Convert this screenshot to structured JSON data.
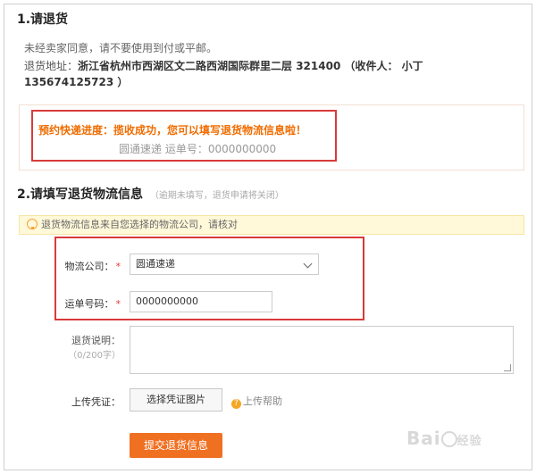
{
  "section1": {
    "title": "1.请退货",
    "notice": "未经卖家同意，请不要使用到付或平邮。",
    "address_label": "退货地址：",
    "address_value": "浙江省杭州市西湖区文二路西湖国际群里二层 321400 （收件人： 小丁",
    "address_phone": "135674125723 ）",
    "progress_title": "预约快递进度：揽收成功，您可以填写退货物流信息啦！",
    "progress_detail": "圆通速递 运单号：0000000000"
  },
  "section2": {
    "title": "2.请填写退货物流信息",
    "subtitle": "（逾期未填写，退货申请将关闭）",
    "hint": "退货物流信息来自您选择的物流公司，请核对",
    "company_label": "物流公司：",
    "company_value": "圆通速递",
    "tracking_label": "运单号码：",
    "tracking_value": "0000000000",
    "required_mark": "*",
    "desc_label": "退货说明：",
    "desc_counter": "（0/200字）",
    "upload_label": "上传凭证：",
    "upload_button": "选择凭证图片",
    "upload_help_icon": "?",
    "upload_help": "上传帮助",
    "submit_button": "提交退货信息"
  },
  "watermark": {
    "text": "Bai",
    "suffix": "经验"
  },
  "colors": {
    "accent_orange": "#f07022",
    "highlight_red": "#d93a3a",
    "progress_orange": "#f06c00"
  }
}
